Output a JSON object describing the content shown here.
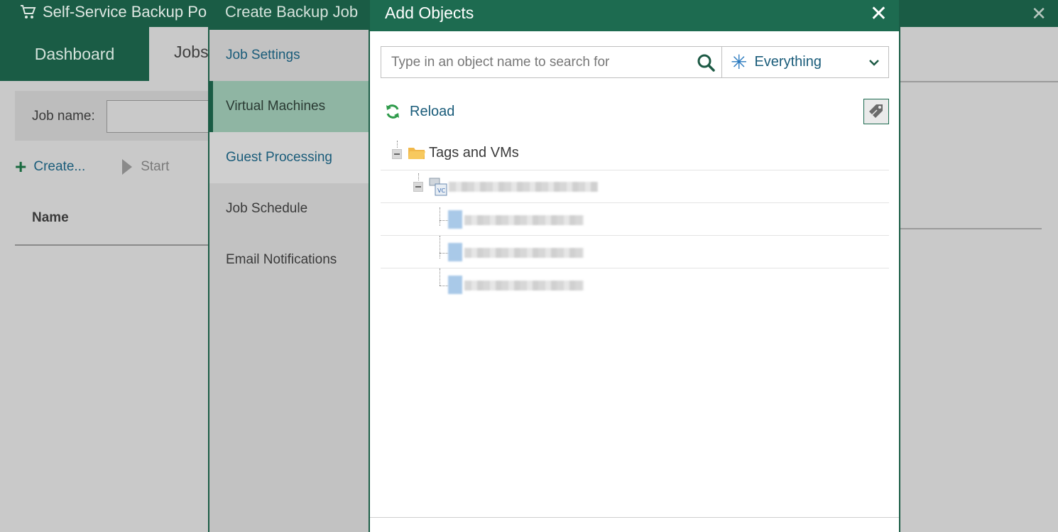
{
  "portal": {
    "title": "Self-Service Backup Po",
    "tabs": {
      "dashboard": "Dashboard",
      "jobs": "Jobs"
    },
    "filter": {
      "job_name_label": "Job name:",
      "job_name_value": ""
    },
    "toolbar": {
      "create_label": "Create...",
      "start_label": "Start"
    },
    "table": {
      "name_header": "Name"
    }
  },
  "wizard": {
    "title": "Create Backup Job",
    "steps": [
      {
        "label": "Job Settings"
      },
      {
        "label": "Virtual Machines"
      },
      {
        "label": "Guest Processing"
      },
      {
        "label": "Job Schedule"
      },
      {
        "label": "Email Notifications"
      }
    ]
  },
  "dialog": {
    "title": "Add Objects",
    "search": {
      "placeholder": "Type in an object name to search for",
      "value": ""
    },
    "scope": {
      "selected": "Everything"
    },
    "reload_label": "Reload",
    "tree": {
      "root_label": "Tags and VMs"
    }
  },
  "colors": {
    "header_green": "#1a5c45",
    "dialog_green": "#1d6b50",
    "link_blue": "#1a5c7a",
    "active_step": "#8fb5a3"
  }
}
